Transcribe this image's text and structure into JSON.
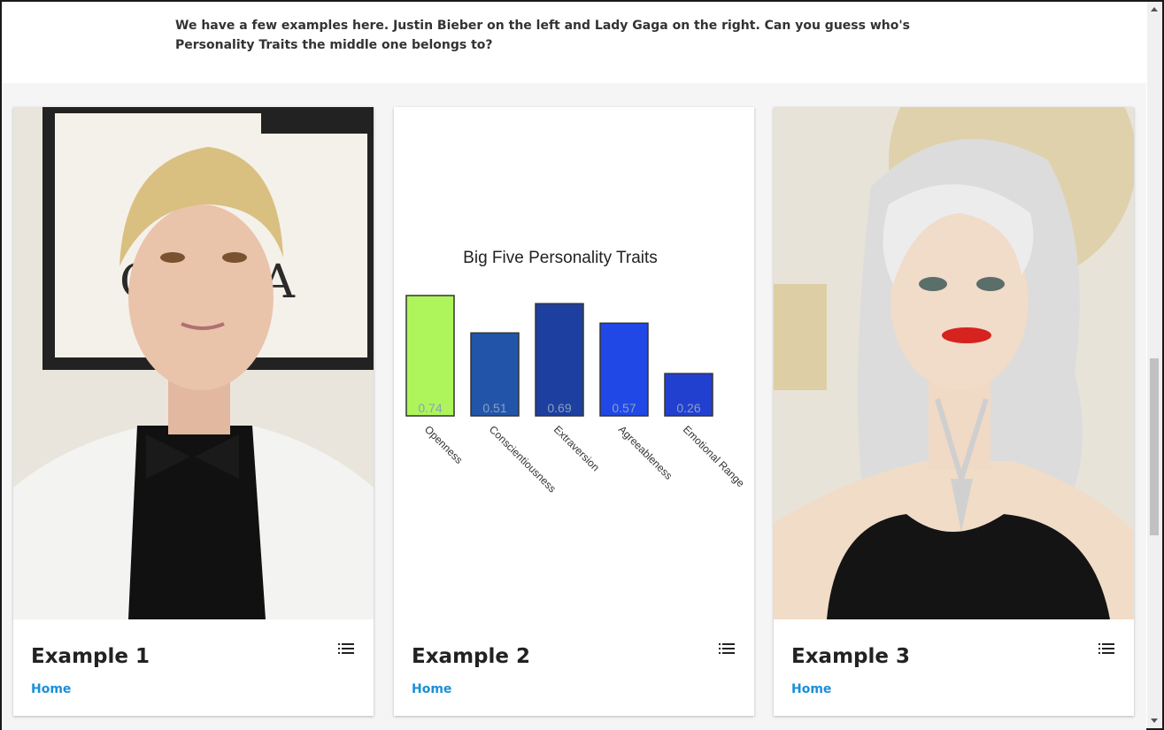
{
  "intro_text": "We have a few examples here. Justin Bieber on the left and Lady Gaga on the right. Can you guess who's Personality Traits the middle one belongs to?",
  "cards": [
    {
      "title": "Example 1",
      "link": "Home",
      "menu_icon": "list-icon",
      "media": "photo-justin-bieber"
    },
    {
      "title": "Example 2",
      "link": "Home",
      "menu_icon": "list-icon",
      "media": "big-five-chart"
    },
    {
      "title": "Example 3",
      "link": "Home",
      "menu_icon": "list-icon",
      "media": "photo-lady-gaga"
    }
  ],
  "colors": {
    "link": "#1a8fd8",
    "title": "#222222",
    "text": "#333333"
  },
  "chart_data": {
    "type": "bar",
    "title": "Big Five Personality Traits",
    "categories": [
      "Openness",
      "Conscientiousness",
      "Extraversion",
      "Agreeableness",
      "Emotional Range"
    ],
    "values": [
      0.74,
      0.51,
      0.69,
      0.57,
      0.26
    ],
    "value_labels": [
      "0.74",
      "0.51",
      "0.69",
      "0.57",
      "0.26"
    ],
    "colors": [
      "#adf55a",
      "#2255aa",
      "#1d3fa0",
      "#2048e6",
      "#2240d0"
    ],
    "xlabel": "",
    "ylabel": "",
    "ylim": [
      0,
      0.74
    ],
    "grid": false
  }
}
